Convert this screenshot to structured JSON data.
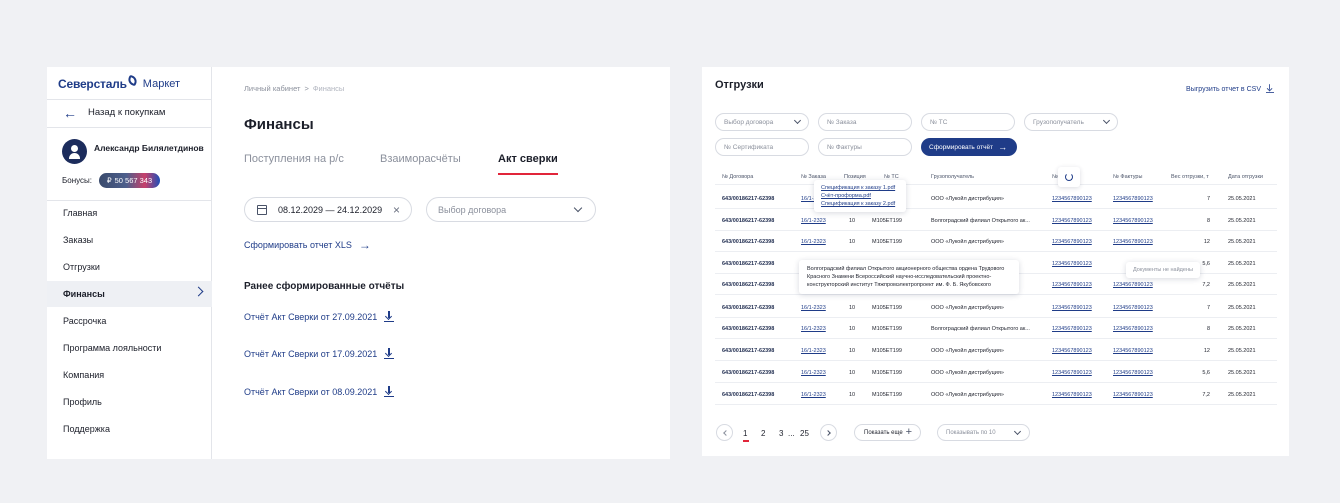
{
  "left": {
    "logo": {
      "brand": "Северсталь",
      "suffix": "Маркет"
    },
    "back_label": "Назад к покупкам",
    "user_name": "Александр Билялетдинов",
    "bonus_label": "Бонусы:",
    "bonus_value": "50 567 343",
    "nav": [
      {
        "label": "Главная"
      },
      {
        "label": "Заказы"
      },
      {
        "label": "Отгрузки"
      },
      {
        "label": "Финансы",
        "active": true
      },
      {
        "label": "Рассрочка"
      },
      {
        "label": "Программа лояльности"
      },
      {
        "label": "Компания"
      },
      {
        "label": "Профиль"
      },
      {
        "label": "Поддержка"
      }
    ],
    "breadcrumbs": [
      "Личный кабинет",
      "Финансы"
    ],
    "title": "Финансы",
    "tabs": [
      "Поступления на р/с",
      "Взаиморасчёты",
      "Акт сверки"
    ],
    "active_tab": "Акт сверки",
    "date_range": "08.12.2029 — 24.12.2029",
    "contract_placeholder": "Выбор договора",
    "generate_label": "Сформировать отчет XLS",
    "previous_title": "Ранее сформированные отчёты",
    "reports": [
      "Отчёт Акт Сверки от 27.09.2021",
      "Отчёт Акт Сверки от 17.09.2021",
      "Отчёт Акт Сверки от 08.09.2021"
    ]
  },
  "right": {
    "title": "Отгрузки",
    "export_label": "Выгрузить отчет в CSV",
    "filters": {
      "contract": "Выбор договора",
      "order": "№ Заказа",
      "vehicle": "№ ТС",
      "consignee": "Грузополучатель",
      "certificate": "№ Сертификата",
      "invoice": "№ Фактуры",
      "generate": "Сформировать отчёт"
    },
    "columns": [
      "№ Договора",
      "№ Заказа",
      "Позиция",
      "№ ТС",
      "Грузополучатель",
      "№ Серт...",
      "№ Фактуры",
      "Вес отгрузки, т",
      "Дата отгрузки"
    ],
    "rows": [
      {
        "contract": "643/00186217-62398",
        "order": "16/1-2323",
        "pos": "10",
        "ts": "M105ET199",
        "consignee": "ООО «Лукойл дистрибуция»",
        "cert": "1234567890123",
        "invoice": "1234567890123",
        "weight": "7",
        "date": "25.05.2021"
      },
      {
        "contract": "643/00186217-62398",
        "order": "16/1-2323",
        "pos": "10",
        "ts": "M105ET199",
        "consignee": "Волгоградский филиал Открытого ак...",
        "cert": "1234567890123",
        "invoice": "1234567890123",
        "weight": "8",
        "date": "25.05.2021"
      },
      {
        "contract": "643/00186217-62398",
        "order": "16/1-2323",
        "pos": "10",
        "ts": "M105ET199",
        "consignee": "ООО «Лукойл дистрибуция»",
        "cert": "1234567890123",
        "invoice": "1234567890123",
        "weight": "12",
        "date": "25.05.2021"
      },
      {
        "contract": "643/00186217-62398",
        "order": "",
        "pos": "",
        "ts": "",
        "consignee": "",
        "cert": "1234567890123",
        "invoice": "",
        "weight": "5,6",
        "date": "25.05.2021"
      },
      {
        "contract": "643/00186217-62398",
        "order": "",
        "pos": "",
        "ts": "",
        "consignee": "",
        "cert": "1234567890123",
        "invoice": "1234567890123",
        "weight": "7,2",
        "date": "25.05.2021"
      },
      {
        "contract": "643/00186217-62398",
        "order": "16/1-2323",
        "pos": "10",
        "ts": "M105ET199",
        "consignee": "ООО «Лукойл дистрибуция»",
        "cert": "1234567890123",
        "invoice": "1234567890123",
        "weight": "7",
        "date": "25.05.2021"
      },
      {
        "contract": "643/00186217-62398",
        "order": "16/1-2323",
        "pos": "10",
        "ts": "M105ET199",
        "consignee": "Волгоградский филиал Открытого ак...",
        "cert": "1234567890123",
        "invoice": "1234567890123",
        "weight": "8",
        "date": "25.05.2021"
      },
      {
        "contract": "643/00186217-62398",
        "order": "16/1-2323",
        "pos": "10",
        "ts": "M105ET199",
        "consignee": "ООО «Лукойл дистрибуция»",
        "cert": "1234567890123",
        "invoice": "1234567890123",
        "weight": "12",
        "date": "25.05.2021"
      },
      {
        "contract": "643/00186217-62398",
        "order": "16/1-2323",
        "pos": "10",
        "ts": "M105ET199",
        "consignee": "ООО «Лукойл дистрибуция»",
        "cert": "1234567890123",
        "invoice": "1234567890123",
        "weight": "5,6",
        "date": "25.05.2021"
      },
      {
        "contract": "643/00186217-62398",
        "order": "16/1-2323",
        "pos": "10",
        "ts": "M105ET199",
        "consignee": "ООО «Лукойл дистрибуция»",
        "cert": "1234567890123",
        "invoice": "1234567890123",
        "weight": "7,2",
        "date": "25.05.2021"
      }
    ],
    "row1_ts_partial": "99",
    "tooltip_specs": [
      "Спецификация к заказу 1.pdf",
      "Счёт-проформа.pdf",
      "Спецификация к заказу 2.pdf"
    ],
    "tooltip_org": "Волгоградский филиал Открытого акционерного общества ордена Трудового Красного Знамени Всероссийский научно-исследовательский проектно-конструкторский институт Тяжпромэлектропроект им. Ф. Б. Якубовского",
    "tooltip_nodocs": "Документы не найдены",
    "pagination": {
      "pages": [
        "1",
        "2",
        "3"
      ],
      "ellipsis": "...",
      "last": "25",
      "current": "1"
    },
    "show_more": "Показать еще",
    "per_page": "Показывать по 10"
  },
  "colors": {
    "accent": "#1f3c88",
    "red": "#e1253a",
    "bg": "#f0f1f4"
  }
}
